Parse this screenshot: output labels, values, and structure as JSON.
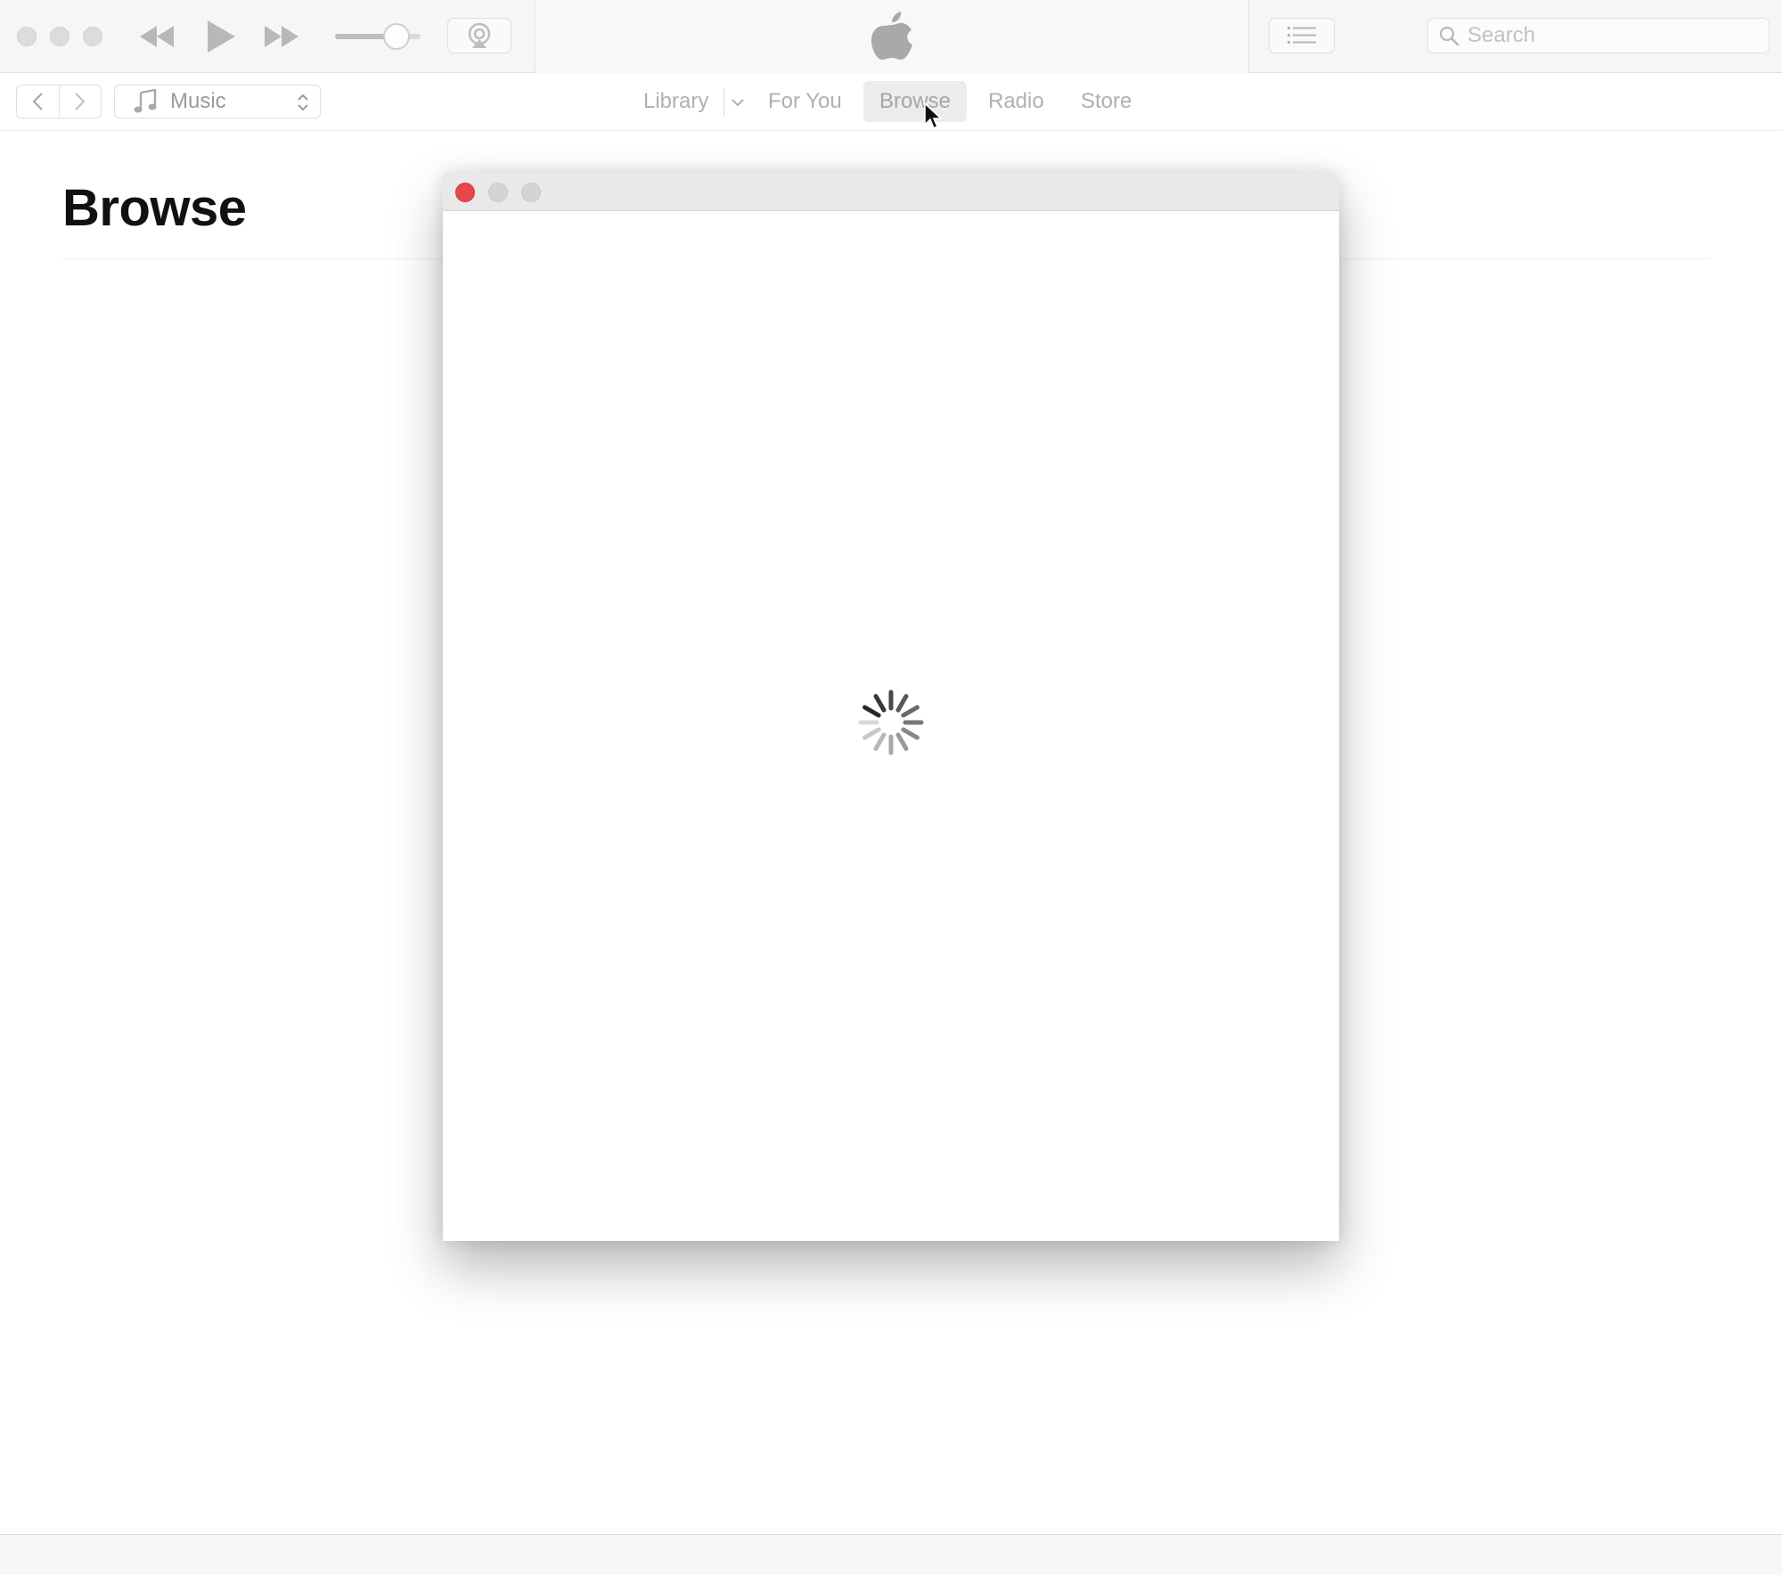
{
  "titlebar": {
    "window_controls": [
      "close",
      "minimize",
      "zoom"
    ],
    "player_controls": {
      "rewind_icon": "rewind-icon",
      "play_icon": "play-icon",
      "fast_forward_icon": "fast-forward-icon"
    },
    "volume_level": 0.72,
    "airplay_icon": "airplay-icon",
    "logo_icon": "apple-logo-icon",
    "list_icon": "up-next-list-icon",
    "search": {
      "placeholder": "Search",
      "value": ""
    }
  },
  "navbar": {
    "back_icon": "chevron-left-icon",
    "forward_icon": "chevron-right-icon",
    "media_picker": {
      "icon": "music-note-icon",
      "selected": "Music"
    },
    "tabs": [
      {
        "label": "Library",
        "active": false
      },
      {
        "label": "For You",
        "active": false
      },
      {
        "label": "Browse",
        "active": true
      },
      {
        "label": "Radio",
        "active": false
      },
      {
        "label": "Store",
        "active": false
      }
    ]
  },
  "main": {
    "title": "Browse"
  },
  "popup": {
    "close_color": "#e8474a",
    "loading": true
  },
  "colors": {
    "titlebar_bg": "#f6f6f6",
    "active_tab_bg": "#ececec",
    "close_red": "#e8474a"
  }
}
